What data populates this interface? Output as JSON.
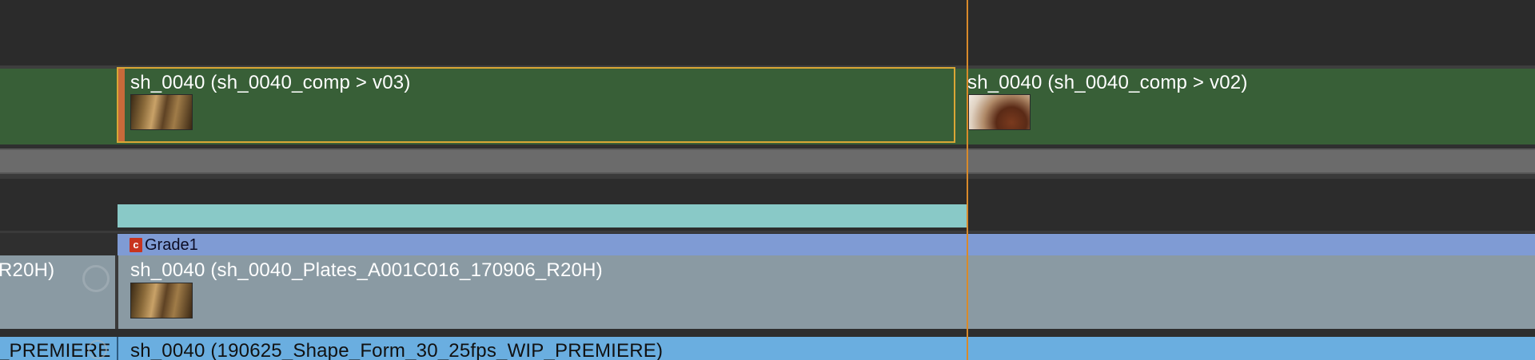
{
  "timeline": {
    "comp_track": {
      "clip_v03": {
        "label": "sh_0040 (sh_0040_comp > v03)"
      },
      "clip_v02": {
        "label": "sh_0040 (sh_0040_comp > v02)"
      }
    },
    "grade_track": {
      "icon_letter": "c",
      "label": "Grade1"
    },
    "plate_track": {
      "left_clip_label": "R20H)",
      "clip_label": "sh_0040 (sh_0040_Plates_A001C016_170906_R20H)"
    },
    "ref_track": {
      "left_clip_label": "_PREMIERE",
      "clip_label": "sh_0040 (190625_Shape_Form_30_25fps_WIP_PREMIERE)"
    }
  },
  "colors": {
    "comp_track": "#385f37",
    "selection_outline": "#d9a636",
    "grade_bar": "#7f9bd4",
    "teal_bar": "#89c9c7",
    "plate_track": "#8a9aa3",
    "ref_track": "#6aaee0",
    "playhead": "#d98a2a"
  }
}
